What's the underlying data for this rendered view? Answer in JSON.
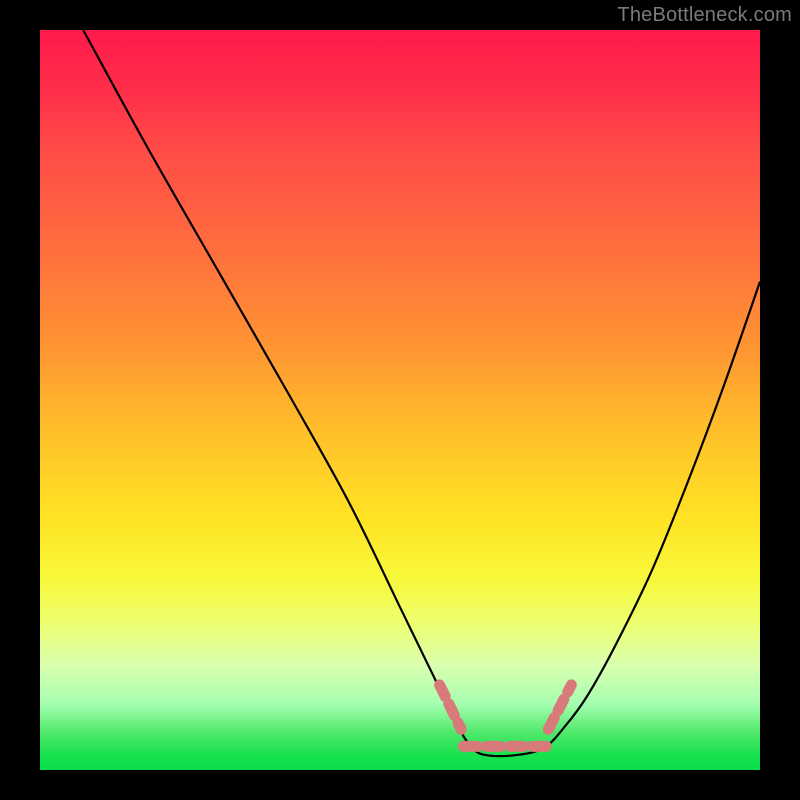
{
  "watermark": "TheBottleneck.com",
  "chart_data": {
    "type": "line",
    "title": "",
    "xlabel": "",
    "ylabel": "",
    "xlim": [
      0,
      100
    ],
    "ylim": [
      0,
      100
    ],
    "series": [
      {
        "name": "bottleneck-curve",
        "color": "#000000",
        "x": [
          6,
          15,
          25,
          35,
          43,
          50,
          55,
          58,
          60,
          62,
          66,
          70,
          73,
          76,
          80,
          85,
          90,
          95,
          100
        ],
        "y": [
          100,
          84,
          67,
          50,
          36,
          22,
          12,
          6,
          3,
          2,
          2,
          3,
          6,
          10,
          17,
          27,
          39,
          52,
          66
        ]
      }
    ],
    "highlight": {
      "name": "optimal-band",
      "color": "#d97a7a",
      "segments": [
        {
          "x": [
            55.5,
            58.5
          ],
          "y": [
            11.5,
            5.5
          ]
        },
        {
          "x": [
            58.8,
            70.3
          ],
          "y": [
            3.2,
            3.2
          ]
        },
        {
          "x": [
            70.6,
            73.8
          ],
          "y": [
            5.5,
            11.5
          ]
        }
      ]
    },
    "gradient_stops": [
      {
        "pct": 0,
        "color": "#ff1a4b"
      },
      {
        "pct": 28,
        "color": "#ff6a3f"
      },
      {
        "pct": 55,
        "color": "#ffc22a"
      },
      {
        "pct": 74,
        "color": "#f8f83a"
      },
      {
        "pct": 91,
        "color": "#a6ffb0"
      },
      {
        "pct": 100,
        "color": "#08dd49"
      }
    ]
  }
}
